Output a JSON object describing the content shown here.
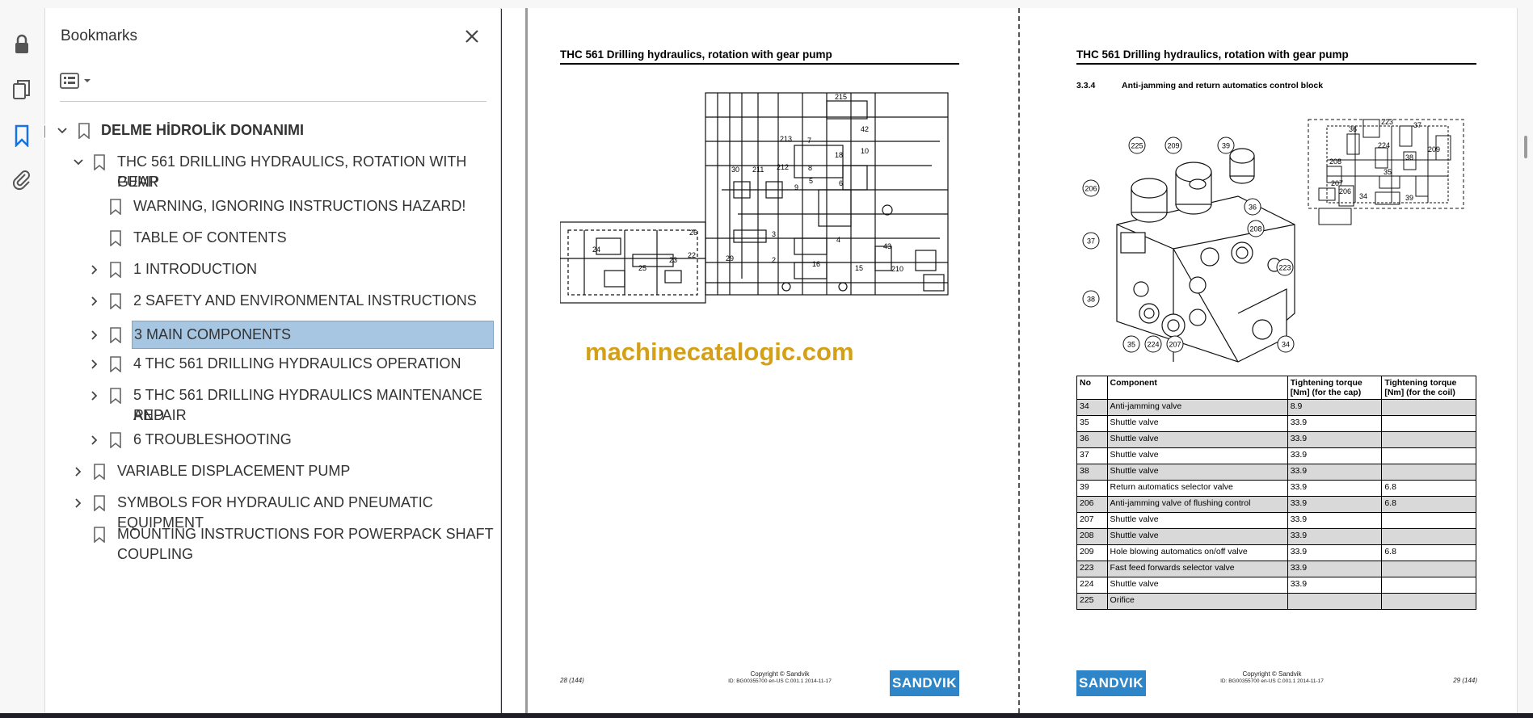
{
  "bookmarks_panel": {
    "title": "Bookmarks",
    "items": [
      {
        "label": "DELME HİDROLİK DONANIMI",
        "expanded": true
      },
      {
        "label": "THC 561 DRILLING HYDRAULICS, ROTATION WITH GEAR",
        "label2": "PUMP",
        "expanded": true
      },
      {
        "label": "WARNING, IGNORING INSTRUCTIONS HAZARD!"
      },
      {
        "label": "TABLE OF CONTENTS"
      },
      {
        "label": "1 INTRODUCTION"
      },
      {
        "label": "2 SAFETY AND ENVIRONMENTAL INSTRUCTIONS"
      },
      {
        "label": "3 MAIN COMPONENTS",
        "selected": true
      },
      {
        "label": "4 THC 561 DRILLING HYDRAULICS OPERATION"
      },
      {
        "label": "5 THC 561 DRILLING HYDRAULICS MAINTENANCE AND",
        "label2": "REPAIR"
      },
      {
        "label": "6 TROUBLESHOOTING"
      },
      {
        "label": "VARIABLE DISPLACEMENT PUMP"
      },
      {
        "label": "SYMBOLS FOR HYDRAULIC AND PNEUMATIC EQUIPMENT"
      },
      {
        "label": "MOUNTING INSTRUCTIONS FOR POWERPACK SHAFT",
        "label2": "COUPLING"
      }
    ]
  },
  "icons": [
    "lock-icon",
    "pages-icon",
    "bookmark-icon",
    "attachment-icon",
    "close-icon",
    "options-icon",
    "chevron-down-icon",
    "chevron-right-icon",
    "collapse-left-icon"
  ],
  "colors": {
    "selected_bg": "#a7c6e1",
    "sandvik_blue": "#2e86c8",
    "watermark": "#d4a017",
    "bookmark_active": "#1473e6"
  },
  "page_left": {
    "title": "THC 561 Drilling hydraulics, rotation with gear pump",
    "watermark": "machinecatalogic.com",
    "page_number": "28 (144)",
    "copyright": "Copyright © Sandvik",
    "doc_id": "ID: BG00355700 en-US C.001.1 2014-11-17",
    "logo": "SANDVIK",
    "diagram_labels": [
      "215",
      "42",
      "10",
      "213",
      "7",
      "212",
      "8",
      "18",
      "30",
      "211",
      "5",
      "6",
      "9",
      "24",
      "26",
      "29",
      "23",
      "22",
      "25",
      "3",
      "2",
      "4",
      "16",
      "15",
      "43",
      "210"
    ]
  },
  "page_right": {
    "title": "THC 561 Drilling hydraulics, rotation with gear pump",
    "section_number": "3.3.4",
    "section_title": "Anti-jamming and return automatics control block",
    "page_number": "29 (144)",
    "copyright": "Copyright © Sandvik",
    "doc_id": "ID: BG00355700 en-US C.001.1 2014-11-17",
    "logo": "SANDVIK",
    "callouts": [
      "225",
      "209",
      "39",
      "206",
      "36",
      "208",
      "37",
      "223",
      "38",
      "35",
      "224",
      "207",
      "34"
    ],
    "schematic_labels": [
      "223",
      "36",
      "37",
      "209",
      "224",
      "38",
      "208",
      "207",
      "35",
      "206",
      "34",
      "39"
    ],
    "table": {
      "headers": [
        "No",
        "Component",
        "Tightening torque [Nm] (for the cap)",
        "Tightening torque [Nm] (for the coil)"
      ],
      "rows": [
        [
          "34",
          "Anti-jamming valve",
          "8.9",
          ""
        ],
        [
          "35",
          "Shuttle valve",
          "33.9",
          ""
        ],
        [
          "36",
          "Shuttle valve",
          "33.9",
          ""
        ],
        [
          "37",
          "Shuttle valve",
          "33.9",
          ""
        ],
        [
          "38",
          "Shuttle valve",
          "33.9",
          ""
        ],
        [
          "39",
          "Return automatics selector valve",
          "33.9",
          "6.8"
        ],
        [
          "206",
          "Anti-jamming valve of flushing control",
          "33.9",
          "6.8"
        ],
        [
          "207",
          "Shuttle valve",
          "33.9",
          ""
        ],
        [
          "208",
          "Shuttle valve",
          "33.9",
          ""
        ],
        [
          "209",
          "Hole blowing automatics on/off valve",
          "33.9",
          "6.8"
        ],
        [
          "223",
          "Fast feed forwards selector valve",
          "33.9",
          ""
        ],
        [
          "224",
          "Shuttle valve",
          "33.9",
          ""
        ],
        [
          "225",
          "Orifice",
          "",
          ""
        ]
      ]
    }
  }
}
